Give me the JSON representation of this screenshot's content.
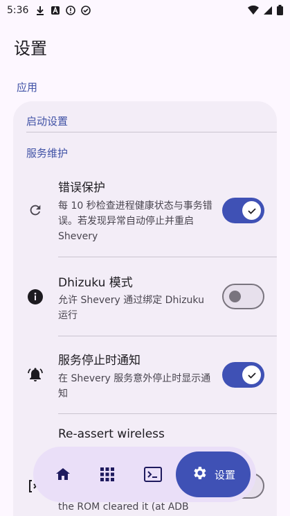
{
  "status_bar": {
    "time": "5:36"
  },
  "page": {
    "title": "设置"
  },
  "sections": {
    "app_label": "应用",
    "startup_label": "启动设置",
    "maintenance_label": "服务维护"
  },
  "settings": [
    {
      "title": "错误保护",
      "desc": "每 10 秒检查进程健康状态与事务错误。若发现异常自动停止并重启 Shevery",
      "enabled": true,
      "icon": "refresh-icon"
    },
    {
      "title": "Dhizuku 模式",
      "desc": "允许 Shevery 通过绑定 Dhizuku 运行",
      "enabled": false,
      "icon": "info-icon"
    },
    {
      "title": "服务停止时通知",
      "desc": "在 Shevery 服务意外停止时显示通知",
      "enabled": true,
      "icon": "bell-icon"
    },
    {
      "title": "Re-assert wireless",
      "desc": "the ROM cleared it (at ADB",
      "enabled": false,
      "icon": "adb-icon"
    }
  ],
  "nav": {
    "items": [
      "home-icon",
      "apps-grid-icon",
      "terminal-icon"
    ],
    "active_label": "设置",
    "active_icon": "gear-icon"
  },
  "colors": {
    "background": "#fdf7ff",
    "card": "#f3edf7",
    "accent": "#3f51b5",
    "section_text": "#3f51a5",
    "nav_bg": "#eadff8"
  }
}
